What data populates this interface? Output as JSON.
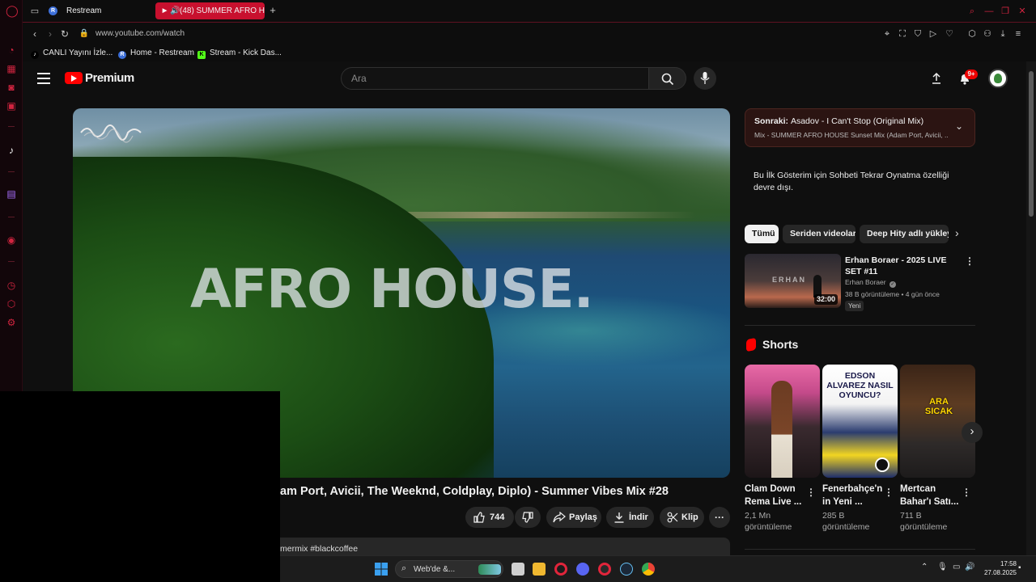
{
  "browser": {
    "tabs": [
      {
        "label": "Restream",
        "fav": "R",
        "active": false
      },
      {
        "label": "(48) SUMMER AFRO H",
        "fav": "▶",
        "active": true
      }
    ],
    "new_tab_label": "+",
    "url": "www.youtube.com/watch",
    "bookmarks": [
      {
        "label": "CANLI Yayını İzle...",
        "icon": "tiktok-icon"
      },
      {
        "label": "Home - Restream",
        "icon": "restream-icon"
      },
      {
        "label": "Stream - Kick Das...",
        "icon": "kick-icon"
      }
    ]
  },
  "youtube": {
    "logo_text": "Premium",
    "search_placeholder": "Ara",
    "notification_count": "9+",
    "video": {
      "overlay_text": "AFRO HOUSE.",
      "title": "am Port, Avicii, The Weeknd, Coldplay, Diplo) - Summer Vibes Mix #28",
      "description_snippet": "mermix #blackcoffee"
    },
    "actions": {
      "like_count": "744",
      "share_label": "Paylaş",
      "download_label": "İndir",
      "clip_label": "Klip",
      "more_label": "···"
    },
    "next_up": {
      "prefix": "Sonraki:",
      "title": "Asadov - I Can't Stop (Original Mix)",
      "subtitle": "Mix - SUMMER AFRO HOUSE Sunset Mix (Adam Port, Avicii, ..."
    },
    "chat_notice": "Bu İlk Gösterim için Sohbeti Tekrar Oynatma özelliği devre dışı.",
    "chips": [
      "Tümü",
      "Seriden videolar",
      "Deep Hity adlı yükleyi"
    ],
    "recommended": {
      "title": "Erhan Boraer - 2025 LIVE SET #11",
      "channel": "Erhan Boraer",
      "meta": "38 B görüntüleme • 4 gün önce",
      "badge": "Yeni",
      "duration": "32:00",
      "thumb_text": "ERHAN"
    },
    "shorts_heading": "Shorts",
    "shorts": [
      {
        "title": "Clam Down Rema Live ...",
        "views": "2,1 Mn görüntüleme"
      },
      {
        "title": "Fenerbahçe'n in Yeni ...",
        "views": "285 B görüntüleme",
        "thumb_text": "EDSON ALVAREZ NASIL OYUNCU?"
      },
      {
        "title": "Mertcan Bahar'ı Satı...",
        "views": "711 B görüntüleme",
        "thumb_text": "ARA SICAK"
      }
    ]
  },
  "taskbar": {
    "search_label": "Web'de &...",
    "time": "17:58",
    "date": "27.08.2025"
  },
  "colors": {
    "opera_red": "#d0243f",
    "youtube_red": "#ff0000",
    "background": "#0f0f0f"
  }
}
